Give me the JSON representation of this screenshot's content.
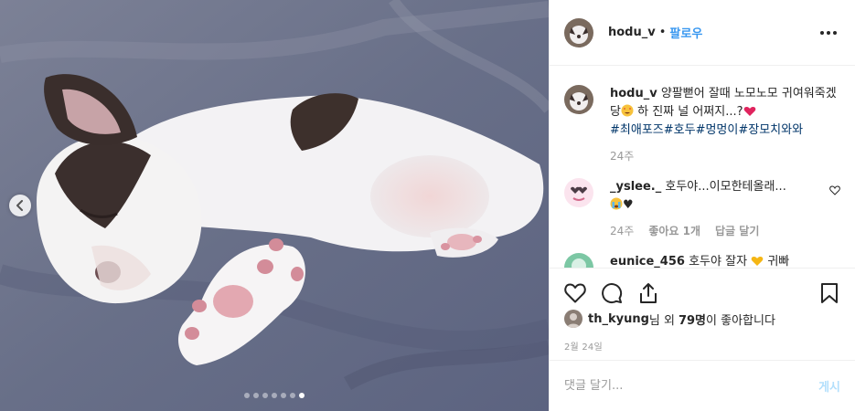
{
  "post": {
    "username": "hodu_v",
    "separator": "•",
    "follow_label": "팔로우",
    "more_icon": "more-options-icon"
  },
  "caption": {
    "username": "hodu_v",
    "text_1": "양팔뻗어 잘때 노모노모 귀여워죽겠당",
    "emoji_1": "star-struck-emoji",
    "text_2": " 하 진짜 널 어쩌지...?",
    "emoji_2": "red-heart-emoji",
    "hashtags": [
      "#최애포즈",
      "#호두",
      "#멍멍이",
      "#장모치와와"
    ],
    "time": "24주"
  },
  "comments": [
    {
      "username": "_yslee._",
      "text": "호두야...이모한테올래...",
      "emojis": [
        "loudly-crying-face-emoji",
        "black-heart"
      ],
      "time": "24주",
      "likes_label": "좋아요 1개",
      "reply_label": "답글 달기"
    },
    {
      "username": "eunice_456",
      "text": "호두야 잘자",
      "tail": "귀빠",
      "emoji": "yellow-heart-emoji"
    }
  ],
  "actions": {
    "like_icon": "heart-icon",
    "comment_icon": "comment-icon",
    "share_icon": "share-icon",
    "save_icon": "bookmark-icon"
  },
  "likes": {
    "user": "th_kyung",
    "text_1": "님 외 ",
    "count": "79명",
    "text_2": "이 좋아합니다"
  },
  "date": "2월 24일",
  "add_comment": {
    "placeholder": "댓글 달기...",
    "post_label": "게시"
  },
  "carousel": {
    "total": 7,
    "active_index": 6,
    "prev_icon": "chevron-left-icon"
  },
  "colors": {
    "link_blue": "#3897f0",
    "hashtag": "#003569",
    "muted": "#999999",
    "border": "#efefef"
  }
}
